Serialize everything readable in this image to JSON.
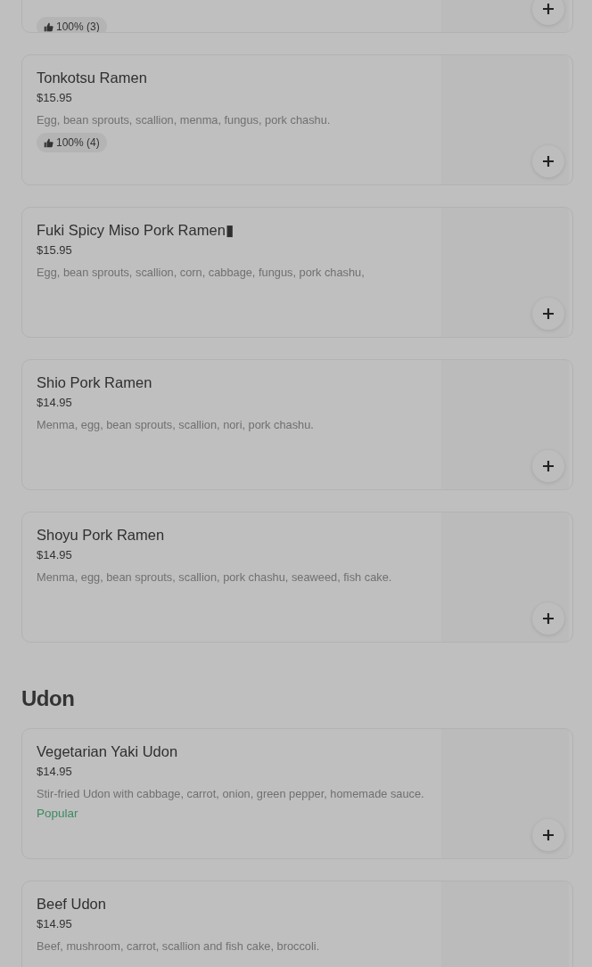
{
  "sections": [
    {
      "items": [
        {
          "rating": "100% (3)",
          "cut": true,
          "add_button": true
        },
        {
          "name": "Tonkotsu Ramen",
          "price": "$15.95",
          "description": "Egg, bean sprouts, scallion, menma, fungus, pork chashu.",
          "rating": "100% (4)",
          "add_button": true
        },
        {
          "name": "Fuki Spicy Miso Pork Ramen▮",
          "price": "$15.95",
          "description": "Egg, bean sprouts, scallion, corn, cabbage, fungus, pork chashu,",
          "add_button": true
        },
        {
          "name": "Shio Pork Ramen",
          "price": "$14.95",
          "description": "Menma, egg, bean sprouts, scallion, nori, pork chashu.",
          "add_button": true
        },
        {
          "name": "Shoyu Pork Ramen",
          "price": "$14.95",
          "description": "Menma, egg, bean sprouts, scallion, pork chashu, seaweed, fish cake.",
          "add_button": true
        }
      ]
    },
    {
      "title": "Udon",
      "items": [
        {
          "name": "Vegetarian Yaki Udon",
          "price": "$14.95",
          "description": "Stir-fried Udon with cabbage, carrot, onion, green pepper, homemade sauce.",
          "tag": "Popular",
          "add_button": true
        },
        {
          "name": "Beef Udon",
          "price": "$14.95",
          "description": "Beef, mushroom, carrot, scallion and fish cake, broccoli.",
          "add_button": false
        }
      ]
    }
  ]
}
